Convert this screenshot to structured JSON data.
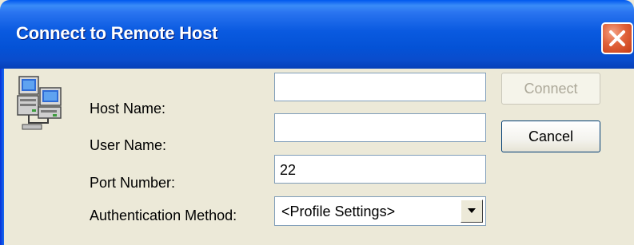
{
  "window": {
    "title": "Connect to Remote Host"
  },
  "form": {
    "host_name": {
      "label": "Host Name:",
      "value": ""
    },
    "user_name": {
      "label": "User Name:",
      "value": ""
    },
    "port_number": {
      "label": "Port Number:",
      "value": "22"
    },
    "auth_method": {
      "label": "Authentication Method:",
      "selected": "<Profile Settings>"
    }
  },
  "buttons": {
    "connect": {
      "label": "Connect",
      "enabled": false
    },
    "cancel": {
      "label": "Cancel",
      "enabled": true
    }
  },
  "icons": {
    "close": "close-icon",
    "network": "networked-computers-icon",
    "dropdown": "chevron-down-icon"
  },
  "colors": {
    "titlebar": "#0452d6",
    "close_button": "#e0623a",
    "dialog_bg": "#ece9d8",
    "disabled_text": "#aca899"
  }
}
